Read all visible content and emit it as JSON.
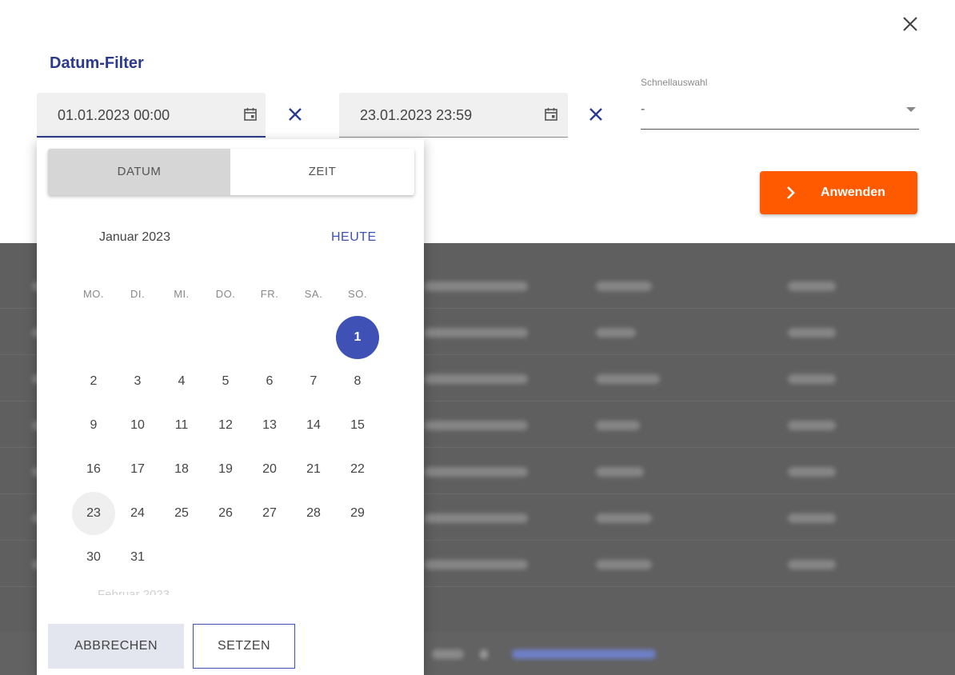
{
  "dialog": {
    "title": "Datum-Filter",
    "from_value": "01.01.2023 00:00",
    "to_value": "23.01.2023 23:59",
    "quick_select": {
      "label": "Schnellauswahl",
      "value": "-"
    },
    "apply_label": "Anwenden"
  },
  "picker": {
    "tabs": [
      "DATUM",
      "ZEIT"
    ],
    "active_tab": "DATUM",
    "month_title": "Januar 2023",
    "today_label": "HEUTE",
    "weekdays": [
      "MO.",
      "DI.",
      "MI.",
      "DO.",
      "FR.",
      "SA.",
      "SO."
    ],
    "days": [
      "1",
      "2",
      "3",
      "4",
      "5",
      "6",
      "7",
      "8",
      "9",
      "10",
      "11",
      "12",
      "13",
      "14",
      "15",
      "16",
      "17",
      "18",
      "19",
      "20",
      "21",
      "22",
      "23",
      "24",
      "25",
      "26",
      "27",
      "28",
      "29",
      "30",
      "31"
    ],
    "selected_day": "1",
    "today_day": "23",
    "next_month_title": "Februar 2023",
    "cancel_label": "ABBRECHEN",
    "set_label": "SETZEN"
  },
  "colors": {
    "accent": "#3f51b5",
    "title": "#2b3a8f",
    "apply": "#ff5a00"
  }
}
